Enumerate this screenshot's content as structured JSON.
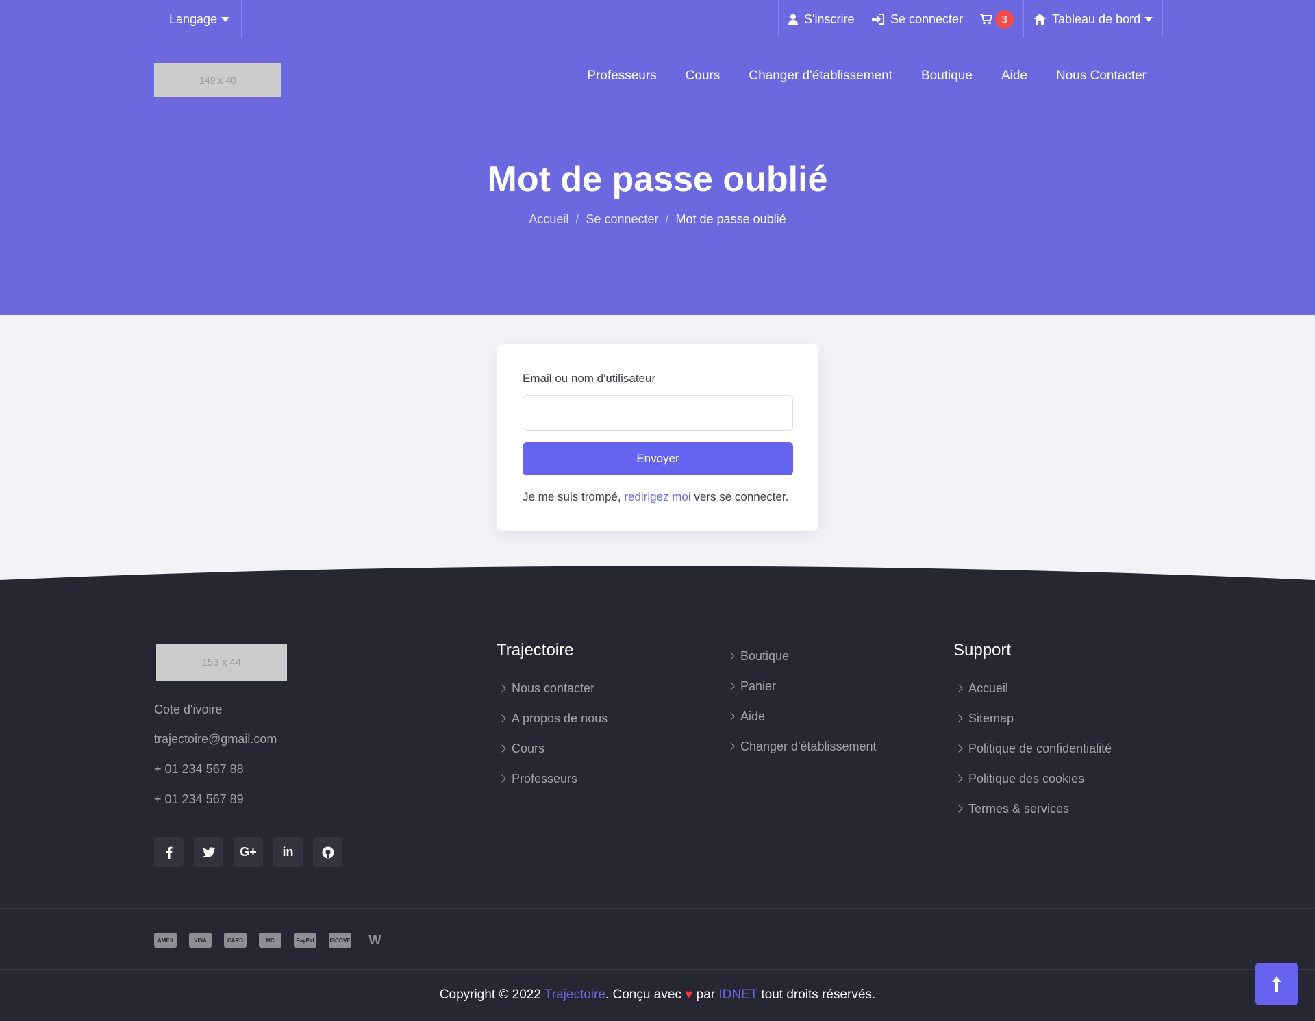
{
  "topbar": {
    "language_label": "Langage",
    "register_label": "S'inscrire",
    "login_label": "Se connecter",
    "cart_count": "3",
    "dashboard_label": "Tableau de bord"
  },
  "header": {
    "logo_placeholder": "149 x 40",
    "nav": [
      "Professeurs",
      "Cours",
      "Changer d'établissement",
      "Boutique",
      "Aide",
      "Nous Contacter"
    ]
  },
  "hero": {
    "title": "Mot de passe oublié",
    "breadcrumb": [
      "Accueil",
      "Se connecter",
      "Mot de passe oublié"
    ]
  },
  "form": {
    "field_label": "Email ou nom d'utilisateur",
    "field_value": "",
    "submit_label": "Envoyer",
    "redirect_prefix": "Je me suis trompé, ",
    "redirect_link": "redirigez moi",
    "redirect_suffix": " vers se connecter."
  },
  "footer": {
    "logo_placeholder": "153 x 44",
    "contact": [
      "Cote d'ivoire",
      "trajectoire@gmail.com",
      "+ 01 234 567 88",
      "+ 01 234 567 89"
    ],
    "socials": [
      "facebook-icon",
      "twitter-icon",
      "google-plus-icon",
      "linkedin-icon",
      "github-icon"
    ],
    "col1_title": "Trajectoire",
    "col1_links": [
      "Nous contacter",
      "A propos de nous",
      "Cours",
      "Professeurs"
    ],
    "col2_links": [
      "Boutique",
      "Panier",
      "Aide",
      "Changer d'établissement"
    ],
    "col3_title": "Support",
    "col3_links": [
      "Accueil",
      "Sitemap",
      "Politique de confidentialité",
      "Politique des cookies",
      "Termes & services"
    ],
    "payments": [
      "AMEX",
      "VISA",
      "CARD",
      "MC",
      "PayPal",
      "DISCOVER",
      "W"
    ],
    "copyright_prefix": "Copyright © 2022 ",
    "copyright_brand": "Trajectoire",
    "copyright_mid": ". Conçu avec ",
    "copyright_by": " par ",
    "copyright_company": "IDNET",
    "copyright_suffix": " tout droits réservés."
  },
  "colors": {
    "primary": "#6c69e0",
    "button": "#6563f0",
    "footer_bg": "#272733",
    "body_bg": "#f3f3f7",
    "badge": "#f14d4d"
  }
}
